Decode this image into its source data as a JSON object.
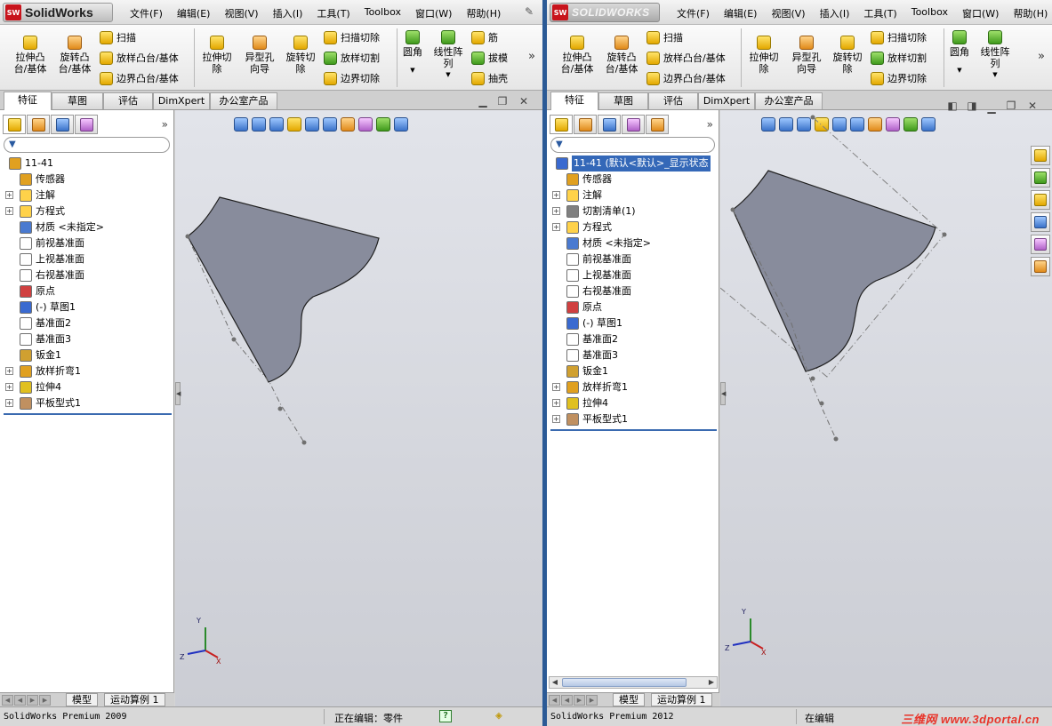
{
  "left": {
    "logo_text": "SolidWorks",
    "logo_badge": "SW",
    "menu": [
      "文件(F)",
      "编辑(E)",
      "视图(V)",
      "插入(I)",
      "工具(T)",
      "Toolbox",
      "窗口(W)",
      "帮助(H)"
    ],
    "ribbon": {
      "extrude_boss": "拉伸凸\n台/基体",
      "revolve_boss": "旋转凸\n台/基体",
      "sweep": "扫描",
      "loft_boss": "放样凸台/基体",
      "boundary_boss": "边界凸台/基体",
      "extrude_cut": "拉伸切\n除",
      "hole_wizard": "异型孔\n向导",
      "revolve_cut": "旋转切\n除",
      "sweep_cut": "扫描切除",
      "loft_cut": "放样切割",
      "boundary_cut": "边界切除",
      "fillet": "圆角",
      "linear_pattern": "线性阵\n列",
      "rib": "筋",
      "draft": "拔模",
      "shell": "抽壳"
    },
    "tabs": [
      "特征",
      "草图",
      "评估",
      "DimXpert",
      "办公室产品"
    ],
    "tree": [
      {
        "label": "11-41",
        "exp": false,
        "root": true,
        "color": "#e0a020"
      },
      {
        "label": "传感器",
        "exp": false,
        "color": "#e0a020"
      },
      {
        "label": "注解",
        "exp": true,
        "color": "#ffd24a"
      },
      {
        "label": "方程式",
        "exp": true,
        "color": "#ffd24a"
      },
      {
        "label": "材质 <未指定>",
        "exp": false,
        "color": "#4a7ad0"
      },
      {
        "label": "前视基准面",
        "exp": false,
        "color": "#ffffff"
      },
      {
        "label": "上视基准面",
        "exp": false,
        "color": "#ffffff"
      },
      {
        "label": "右视基准面",
        "exp": false,
        "color": "#ffffff"
      },
      {
        "label": "原点",
        "exp": false,
        "color": "#d04040"
      },
      {
        "label": "(-) 草图1",
        "exp": false,
        "color": "#3a6ad0"
      },
      {
        "label": "基准面2",
        "exp": false,
        "color": "#ffffff"
      },
      {
        "label": "基准面3",
        "exp": false,
        "color": "#ffffff"
      },
      {
        "label": "钣金1",
        "exp": false,
        "color": "#d0a030"
      },
      {
        "label": "放样折弯1",
        "exp": true,
        "color": "#e0a020"
      },
      {
        "label": "拉伸4",
        "exp": true,
        "color": "#e0c020"
      },
      {
        "label": "平板型式1",
        "exp": true,
        "color": "#c09060"
      }
    ],
    "bottom_tabs": [
      "模型",
      "运动算例 1"
    ],
    "status_version": "SolidWorks Premium 2009",
    "status_editing": "正在编辑：零件",
    "help_glyph": "?"
  },
  "right": {
    "logo_text": "SOLIDWORKS",
    "logo_badge": "SW",
    "menu": [
      "文件(F)",
      "编辑(E)",
      "视图(V)",
      "插入(I)",
      "工具(T)",
      "Toolbox",
      "窗口(W)",
      "帮助(H)"
    ],
    "ribbon": {
      "extrude_boss": "拉伸凸\n台/基体",
      "revolve_boss": "旋转凸\n台/基体",
      "sweep": "扫描",
      "loft_boss": "放样凸台/基体",
      "boundary_boss": "边界凸台/基体",
      "extrude_cut": "拉伸切\n除",
      "hole_wizard": "异型孔\n向导",
      "revolve_cut": "旋转切\n除",
      "sweep_cut": "扫描切除",
      "loft_cut": "放样切割",
      "boundary_cut": "边界切除",
      "fillet": "圆角",
      "linear_pattern": "线性阵\n列"
    },
    "tabs": [
      "特征",
      "草图",
      "评估",
      "DimXpert",
      "办公室产品"
    ],
    "tree": [
      {
        "label": "11-41  (默认<默认>_显示状态",
        "exp": false,
        "root": true,
        "color": "#3a6ad0"
      },
      {
        "label": "传感器",
        "exp": false,
        "color": "#e0a020"
      },
      {
        "label": "注解",
        "exp": true,
        "color": "#ffd24a"
      },
      {
        "label": "切割清单(1)",
        "exp": true,
        "color": "#808080"
      },
      {
        "label": "方程式",
        "exp": true,
        "color": "#ffd24a"
      },
      {
        "label": "材质 <未指定>",
        "exp": false,
        "color": "#4a7ad0"
      },
      {
        "label": "前视基准面",
        "exp": false,
        "color": "#ffffff"
      },
      {
        "label": "上视基准面",
        "exp": false,
        "color": "#ffffff"
      },
      {
        "label": "右视基准面",
        "exp": false,
        "color": "#ffffff"
      },
      {
        "label": "原点",
        "exp": false,
        "color": "#d04040"
      },
      {
        "label": "(-) 草图1",
        "exp": false,
        "color": "#3a6ad0"
      },
      {
        "label": "基准面2",
        "exp": false,
        "color": "#ffffff"
      },
      {
        "label": "基准面3",
        "exp": false,
        "color": "#ffffff"
      },
      {
        "label": "钣金1",
        "exp": false,
        "color": "#d0a030"
      },
      {
        "label": "放样折弯1",
        "exp": true,
        "color": "#e0a020"
      },
      {
        "label": "拉伸4",
        "exp": true,
        "color": "#e0c020"
      },
      {
        "label": "平板型式1",
        "exp": true,
        "color": "#c09060"
      }
    ],
    "bottom_tabs": [
      "模型",
      "运动算例 1"
    ],
    "status_version": "SolidWorks Premium 2012",
    "status_editing": "在编辑",
    "watermark": "三维网 www.3dportal.cn"
  },
  "triad": {
    "x": "X",
    "y": "Y",
    "z": "Z"
  },
  "colors": {
    "part_fill": "#888c9c",
    "viewport_top": "#e2e4ea",
    "viewport_bottom": "#cbcdd4",
    "selection": "#3468b8"
  }
}
